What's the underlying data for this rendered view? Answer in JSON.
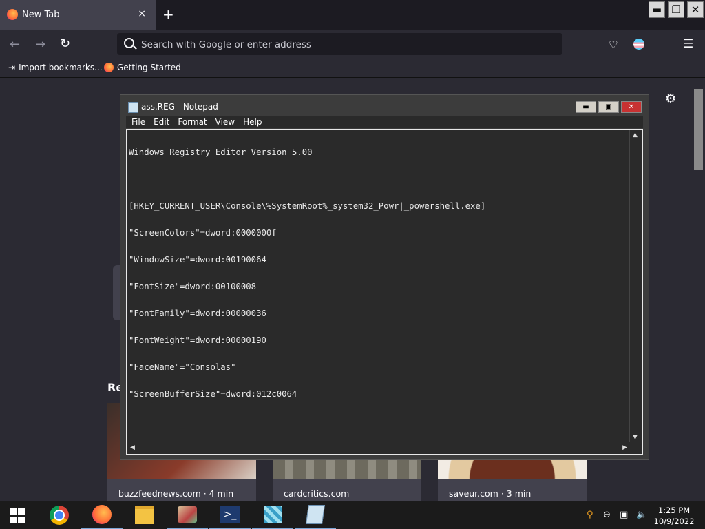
{
  "browser": {
    "tab_title": "New Tab",
    "tab_close": "×",
    "new_tab": "+",
    "address_placeholder": "Search with Google or enter address",
    "bookmarks": [
      {
        "label": "Import bookmarks...",
        "icon": "import-icon"
      },
      {
        "label": "Getting Started",
        "icon": "firefox-icon"
      }
    ],
    "window_controls": [
      "▬",
      "❐",
      "✕"
    ]
  },
  "newtab_page": {
    "recent_heading": "Re",
    "cards": [
      {
        "label": "buzzfeednews.com · 4 min"
      },
      {
        "label": "cardcritics.com"
      },
      {
        "label": "saveur.com · 3 min"
      }
    ]
  },
  "notepad": {
    "title": "ass.REG - Notepad",
    "menu": [
      "File",
      "Edit",
      "Format",
      "View",
      "Help"
    ],
    "lines": [
      "Windows Registry Editor Version 5.00",
      "",
      "[HKEY_CURRENT_USER\\Console\\%SystemRoot%_system32_Powr|_powershell.exe]",
      "\"ScreenColors\"=dword:0000000f",
      "\"WindowSize\"=dword:00190064",
      "\"FontSize\"=dword:00100008",
      "\"FontFamily\"=dword:00000036",
      "\"FontWeight\"=dword:00000190",
      "\"FaceName\"=\"Consolas\"",
      "\"ScreenBufferSize\"=dword:012c0064"
    ]
  },
  "taskbar": {
    "apps": [
      "chrome-icon",
      "firefox-icon",
      "file-explorer-icon",
      "paint-icon",
      "powershell-icon",
      "regedit-icon",
      "notepad-icon"
    ],
    "time": "1:25 PM",
    "date": "10/9/2022"
  },
  "colors": {
    "accent": "#7aa6d6",
    "browser_bg": "#2b2a33",
    "notepad_bg": "#2a2a2a"
  }
}
